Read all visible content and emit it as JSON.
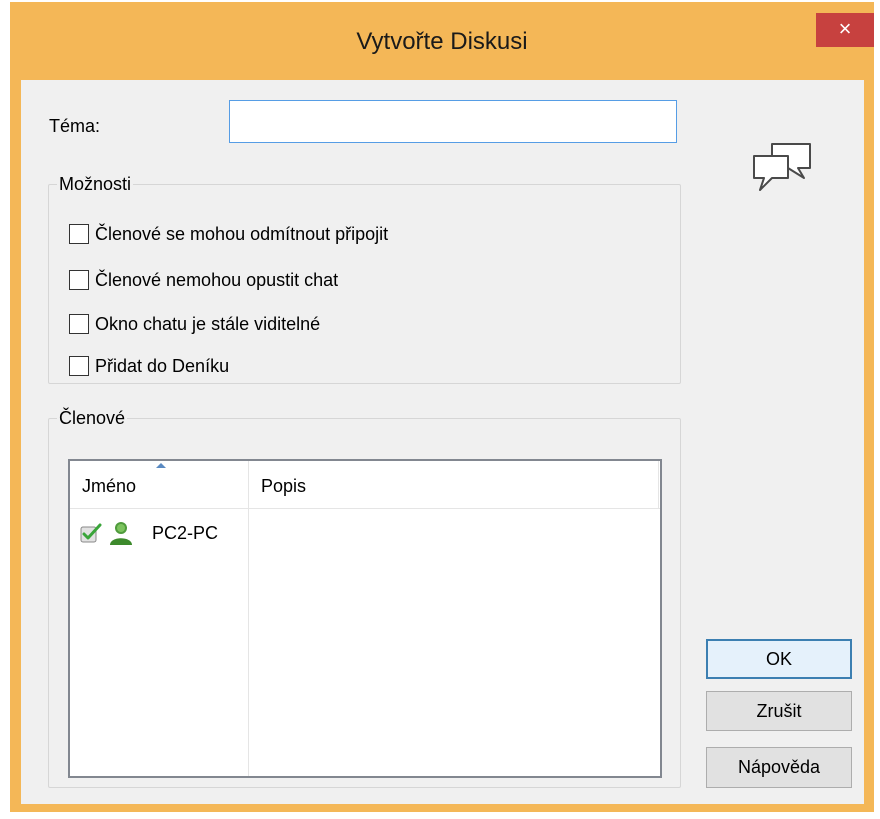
{
  "dialog": {
    "title": "Vytvořte Diskusi",
    "close_glyph": "×"
  },
  "topic": {
    "label": "Téma:",
    "value": ""
  },
  "options": {
    "legend": "Možnosti",
    "items": [
      {
        "label": "Členové se mohou odmítnout připojit",
        "checked": false
      },
      {
        "label": "Členové nemohou opustit chat",
        "checked": false
      },
      {
        "label": "Okno chatu je stále viditelné",
        "checked": false
      },
      {
        "label": "Přidat do Deníku",
        "checked": false
      }
    ]
  },
  "members": {
    "legend": "Členové",
    "columns": [
      "Jméno",
      "Popis"
    ],
    "sort_column": "Jméno",
    "rows": [
      {
        "name": "PC2-PC",
        "description": "",
        "checked": true,
        "icon": "user-icon"
      }
    ]
  },
  "buttons": {
    "ok": "OK",
    "cancel": "Zrušit",
    "help": "Nápověda"
  },
  "icons": {
    "header": "chat-bubbles-icon"
  },
  "colors": {
    "title_bar": "#f4b757",
    "close_button": "#c7413f",
    "focus_border": "#569de5",
    "default_button_border": "#3c7fb1"
  }
}
